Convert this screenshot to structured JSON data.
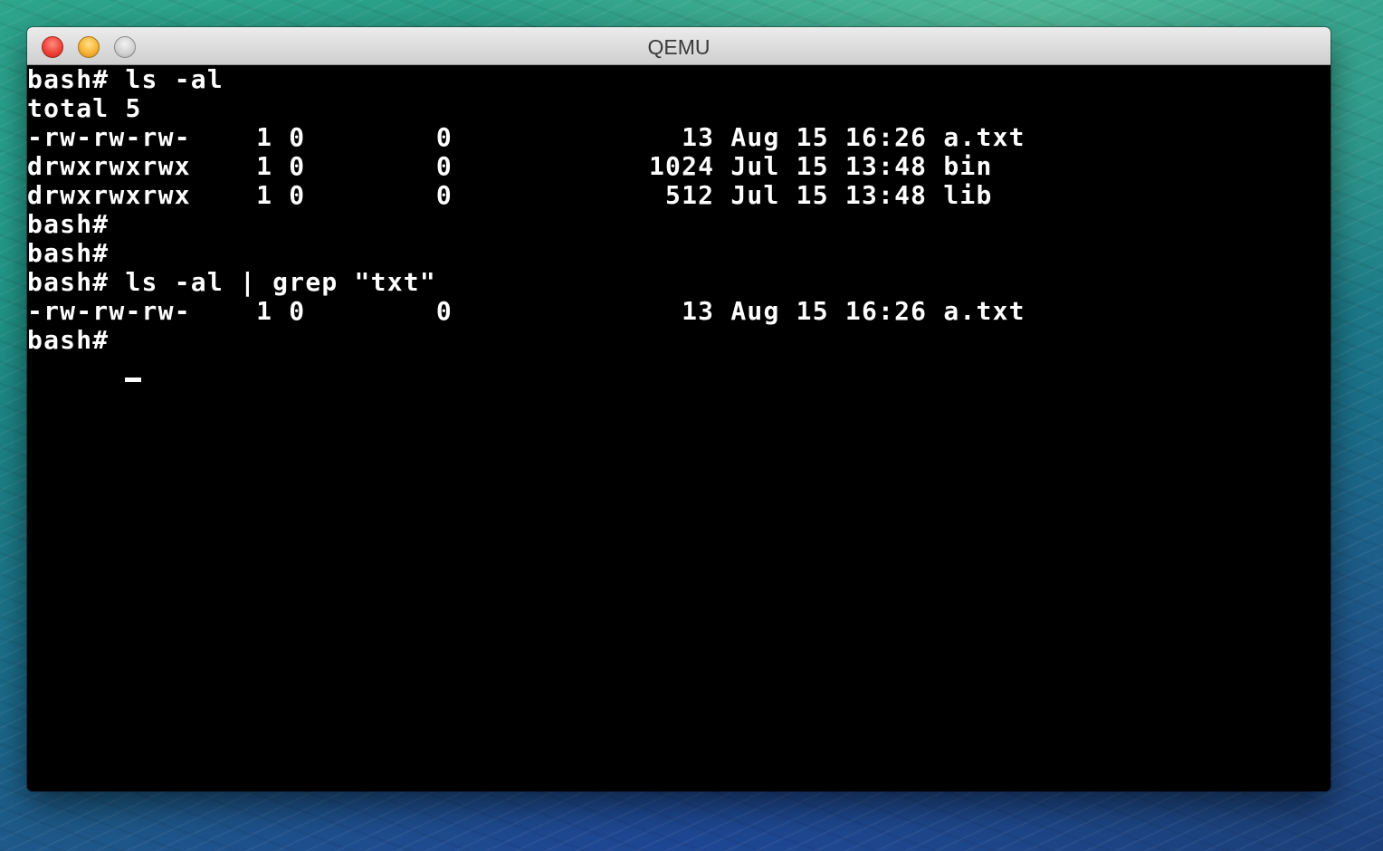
{
  "window": {
    "title": "QEMU"
  },
  "terminal": {
    "lines": [
      "bash# ls -al",
      "total 5",
      "-rw-rw-rw-    1 0        0              13 Aug 15 16:26 a.txt",
      "drwxrwxrwx    1 0        0            1024 Jul 15 13:48 bin",
      "drwxrwxrwx    1 0        0             512 Jul 15 13:48 lib",
      "bash#",
      "bash#",
      "bash# ls -al | grep \"txt\"",
      "-rw-rw-rw-    1 0        0              13 Aug 15 16:26 a.txt",
      "bash#"
    ]
  },
  "colors": {
    "terminal_background": "#000000",
    "terminal_text": "#ffffff",
    "close_button": "#f0433a",
    "minimize_button": "#f6b436",
    "zoom_button": "#d0d0d0"
  }
}
